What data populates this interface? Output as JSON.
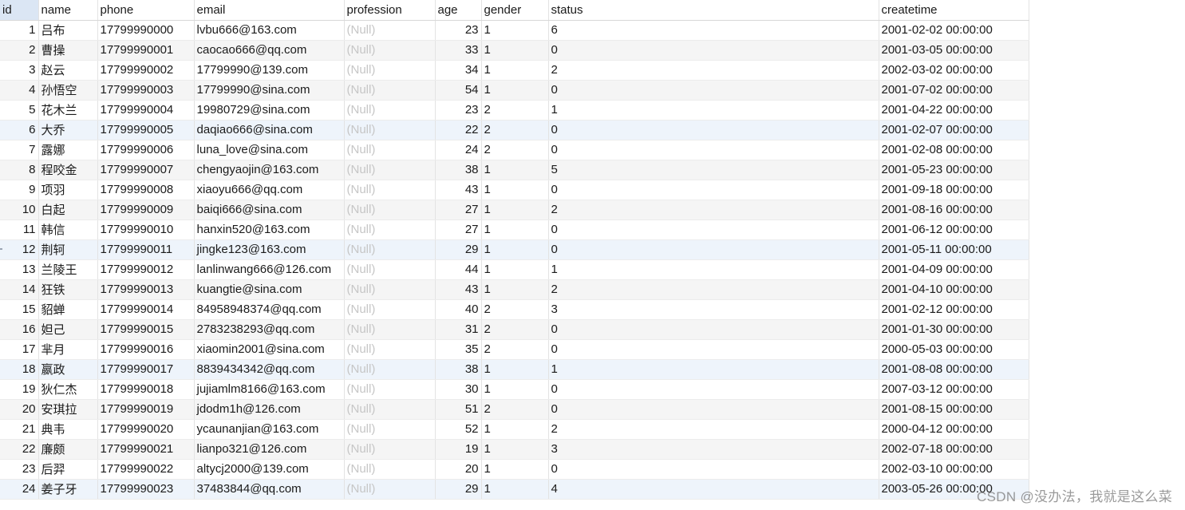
{
  "columns": [
    "id",
    "name",
    "phone",
    "email",
    "profession",
    "age",
    "gender",
    "status",
    "createtime"
  ],
  "rows": [
    [
      "1",
      "吕布",
      "17799990000",
      "lvbu666@163.com",
      "(Null)",
      "23",
      "1",
      "6",
      "2001-02-02 00:00:00"
    ],
    [
      "2",
      "曹操",
      "17799990001",
      "caocao666@qq.com",
      "(Null)",
      "33",
      "1",
      "0",
      "2001-03-05 00:00:00"
    ],
    [
      "3",
      "赵云",
      "17799990002",
      "17799990@139.com",
      "(Null)",
      "34",
      "1",
      "2",
      "2002-03-02 00:00:00"
    ],
    [
      "4",
      "孙悟空",
      "17799990003",
      "17799990@sina.com",
      "(Null)",
      "54",
      "1",
      "0",
      "2001-07-02 00:00:00"
    ],
    [
      "5",
      "花木兰",
      "17799990004",
      "19980729@sina.com",
      "(Null)",
      "23",
      "2",
      "1",
      "2001-04-22 00:00:00"
    ],
    [
      "6",
      "大乔",
      "17799990005",
      "daqiao666@sina.com",
      "(Null)",
      "22",
      "2",
      "0",
      "2001-02-07 00:00:00"
    ],
    [
      "7",
      "露娜",
      "17799990006",
      "luna_love@sina.com",
      "(Null)",
      "24",
      "2",
      "0",
      "2001-02-08 00:00:00"
    ],
    [
      "8",
      "程咬金",
      "17799990007",
      "chengyaojin@163.com",
      "(Null)",
      "38",
      "1",
      "5",
      "2001-05-23 00:00:00"
    ],
    [
      "9",
      "项羽",
      "17799990008",
      "xiaoyu666@qq.com",
      "(Null)",
      "43",
      "1",
      "0",
      "2001-09-18 00:00:00"
    ],
    [
      "10",
      "白起",
      "17799990009",
      "baiqi666@sina.com",
      "(Null)",
      "27",
      "1",
      "2",
      "2001-08-16 00:00:00"
    ],
    [
      "11",
      "韩信",
      "17799990010",
      "hanxin520@163.com",
      "(Null)",
      "27",
      "1",
      "0",
      "2001-06-12 00:00:00"
    ],
    [
      "12",
      "荆轲",
      "17799990011",
      "jingke123@163.com",
      "(Null)",
      "29",
      "1",
      "0",
      "2001-05-11 00:00:00"
    ],
    [
      "13",
      "兰陵王",
      "17799990012",
      "lanlinwang666@126.com",
      "(Null)",
      "44",
      "1",
      "1",
      "2001-04-09 00:00:00"
    ],
    [
      "14",
      "狂铁",
      "17799990013",
      "kuangtie@sina.com",
      "(Null)",
      "43",
      "1",
      "2",
      "2001-04-10 00:00:00"
    ],
    [
      "15",
      "貂蝉",
      "17799990014",
      "84958948374@qq.com",
      "(Null)",
      "40",
      "2",
      "3",
      "2001-02-12 00:00:00"
    ],
    [
      "16",
      "妲己",
      "17799990015",
      "2783238293@qq.com",
      "(Null)",
      "31",
      "2",
      "0",
      "2001-01-30 00:00:00"
    ],
    [
      "17",
      "芈月",
      "17799990016",
      "xiaomin2001@sina.com",
      "(Null)",
      "35",
      "2",
      "0",
      "2000-05-03 00:00:00"
    ],
    [
      "18",
      "嬴政",
      "17799990017",
      "8839434342@qq.com",
      "(Null)",
      "38",
      "1",
      "1",
      "2001-08-08 00:00:00"
    ],
    [
      "19",
      "狄仁杰",
      "17799990018",
      "jujiamlm8166@163.com",
      "(Null)",
      "30",
      "1",
      "0",
      "2007-03-12 00:00:00"
    ],
    [
      "20",
      "安琪拉",
      "17799990019",
      "jdodm1h@126.com",
      "(Null)",
      "51",
      "2",
      "0",
      "2001-08-15 00:00:00"
    ],
    [
      "21",
      "典韦",
      "17799990020",
      "ycaunanjian@163.com",
      "(Null)",
      "52",
      "1",
      "2",
      "2000-04-12 00:00:00"
    ],
    [
      "22",
      "廉颇",
      "17799990021",
      "lianpo321@126.com",
      "(Null)",
      "19",
      "1",
      "3",
      "2002-07-18 00:00:00"
    ],
    [
      "23",
      "后羿",
      "17799990022",
      "altycj2000@139.com",
      "(Null)",
      "20",
      "1",
      "0",
      "2002-03-10 00:00:00"
    ],
    [
      "24",
      "姜子牙",
      "17799990023",
      "37483844@qq.com",
      "(Null)",
      "29",
      "1",
      "4",
      "2003-05-26 00:00:00"
    ]
  ],
  "watermark": "CSDN @没办法，我就是这么菜",
  "colors": {
    "selected_header": "#dbe6f4",
    "null_text": "#c6c6c6",
    "stripe": "#f5f5f5",
    "highlight": "#eef4fb"
  }
}
